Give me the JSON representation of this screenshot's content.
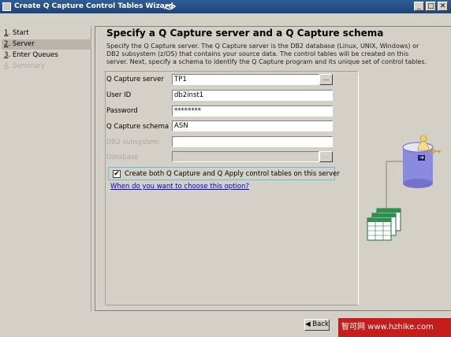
{
  "window": {
    "title": "Create Q Capture Control Tables Wizard",
    "min_label": "_",
    "max_label": "□",
    "close_label": "✕"
  },
  "nav": {
    "items": [
      {
        "num": "1",
        "label": ". Start",
        "state": "normal"
      },
      {
        "num": "2",
        "label": ". Server",
        "state": "selected"
      },
      {
        "num": "3",
        "label": ". Enter Queues",
        "state": "normal"
      },
      {
        "num": "4",
        "label": ". Summary",
        "state": "disabled"
      }
    ]
  },
  "main": {
    "heading": "Specify a Q Capture server and a Q Capture schema",
    "description_lines": [
      "Specify the Q Capture server.  The Q Capture server is the DB2 database (Linux, UNIX, Windows) or",
      "DB2 subsystem (z/OS) that contains your source data. The control tables will be created on this",
      "server. Next, specify a schema to identify the Q Capture program and its unique set of control tables."
    ]
  },
  "form": {
    "capture_server_label": "Q Capture server",
    "capture_server_value": "TP1",
    "user_id_label": "User ID",
    "user_id_value": "db2inst1",
    "password_label": "Password",
    "password_value": "********",
    "schema_label": "Q Capture schema",
    "schema_value": "ASN",
    "db2_subsystem_label": "DB2 subsystem",
    "db2_subsystem_value": "",
    "database_label": "Database",
    "database_value": "",
    "ellipsis_label": "...",
    "checkbox_label": "Create both Q Capture and Q Apply control tables on this server",
    "checkbox_checked": "✔",
    "link_text": "When do you want to choose this option?"
  },
  "footer": {
    "back_label": "◀ Back",
    "watermark": "智可网 www.hzhike.com"
  },
  "colors": {
    "title_bar": "#2f5d96",
    "link": "#0000cc",
    "focus_border": "#62c2d2",
    "watermark_bg": "#c61c1c"
  },
  "icons": [
    "window-icon",
    "database-server-icon",
    "user-key-icon",
    "control-tables-icon"
  ]
}
